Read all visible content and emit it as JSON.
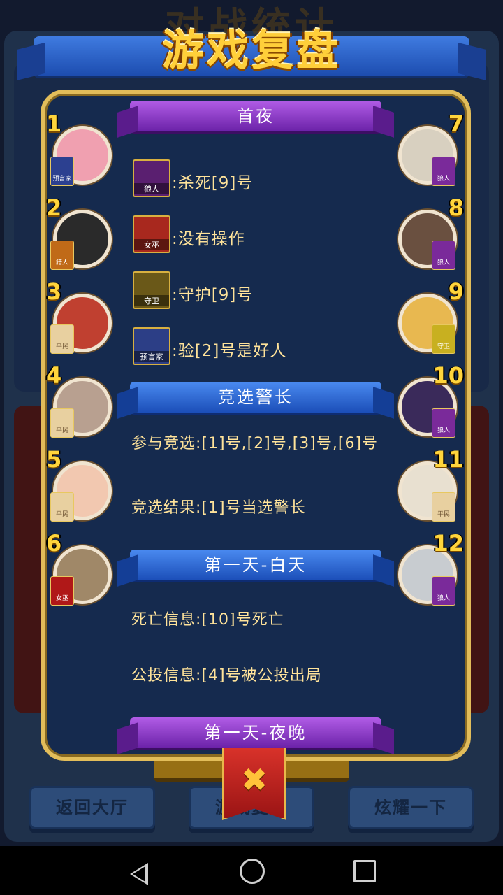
{
  "background": {
    "title": "对战统计",
    "under_button": "",
    "buttons": [
      "返回大厅",
      "游戏复盘",
      "炫耀一下"
    ]
  },
  "modal": {
    "title": "游戏复盘",
    "sections": [
      {
        "title": "首夜",
        "style": "purple"
      },
      {
        "title": "竞选警长",
        "style": "blue"
      },
      {
        "title": "第一天-白天",
        "style": "blue"
      },
      {
        "title": "第一天-夜晚",
        "style": "purple"
      }
    ],
    "night_actions": [
      {
        "role": "狼人",
        "color": "#5a1f70",
        "text": ":杀死[9]号"
      },
      {
        "role": "女巫",
        "color": "#a8281e",
        "text": ":没有操作"
      },
      {
        "role": "守卫",
        "color": "#6a5818",
        "text": ":守护[9]号"
      },
      {
        "role": "预言家",
        "color": "#2c3e86",
        "text": ":验[2]号是好人"
      }
    ],
    "sheriff": {
      "participants": "参与竞选:[1]号,[2]号,[3]号,[6]号",
      "result": "竞选结果:[1]号当选警长"
    },
    "day1": {
      "death": "死亡信息:[10]号死亡",
      "vote": "公投信息:[4]号被公投出局"
    },
    "players_left": [
      {
        "num": "1",
        "role": "预言家",
        "card": "#2c4090",
        "avatar": "#f0a0b0"
      },
      {
        "num": "2",
        "role": "猎人",
        "card": "#c06a18",
        "avatar": "#2a2a2a"
      },
      {
        "num": "3",
        "role": "平民",
        "card": "#e8d0a0",
        "avatar": "#c04030"
      },
      {
        "num": "4",
        "role": "平民",
        "card": "#e8d0a0",
        "avatar": "#b8a090"
      },
      {
        "num": "5",
        "role": "平民",
        "card": "#e8d0a0",
        "avatar": "#f2c8b0"
      },
      {
        "num": "6",
        "role": "女巫",
        "card": "#b01818",
        "avatar": "#a08868"
      }
    ],
    "players_right": [
      {
        "num": "7",
        "role": "狼人",
        "card": "#7a2a9a",
        "avatar": "#d8d0c0"
      },
      {
        "num": "8",
        "role": "狼人",
        "card": "#7a2a9a",
        "avatar": "#6a5040"
      },
      {
        "num": "9",
        "role": "守卫",
        "card": "#c8b020",
        "avatar": "#e8b850"
      },
      {
        "num": "10",
        "role": "狼人",
        "card": "#7a2a9a",
        "avatar": "#3a2a5a"
      },
      {
        "num": "11",
        "role": "平民",
        "card": "#e8d0a0",
        "avatar": "#e8e0d0"
      },
      {
        "num": "12",
        "role": "狼人",
        "card": "#7a2a9a",
        "avatar": "#c8ccd0"
      }
    ]
  },
  "close_icon": "close-icon",
  "nav": [
    "back-icon",
    "home-icon",
    "recents-icon"
  ]
}
